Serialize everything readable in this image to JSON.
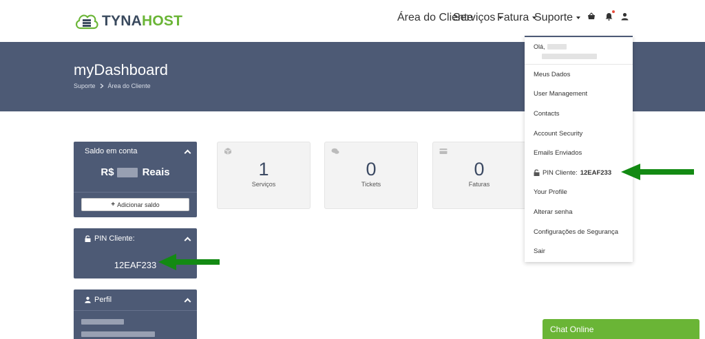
{
  "brand": {
    "name_part1": "TYNA",
    "name_part2": "HOST"
  },
  "nav": {
    "area_cliente": "Área do Cliente",
    "servicos": "Serviços",
    "fatura": "Fatura",
    "suporte": "Suporte"
  },
  "banner": {
    "title": "myDashboard",
    "breadcrumb": [
      "Suporte",
      "Área do Cliente"
    ]
  },
  "saldo_panel": {
    "title": "Saldo em conta",
    "currency": "R$",
    "unit": "Reais",
    "add_button": "Adicionar saldo"
  },
  "pin_panel": {
    "title": "PIN Cliente:",
    "value": "12EAF233"
  },
  "perfil_panel": {
    "title": "Perfil"
  },
  "stats": [
    {
      "value": "1",
      "label": "Serviços",
      "icon": "cube-icon"
    },
    {
      "value": "0",
      "label": "Tickets",
      "icon": "comments-icon"
    },
    {
      "value": "0",
      "label": "Faturas",
      "icon": "credit-card-icon"
    }
  ],
  "dropdown": {
    "hello": "Olá,",
    "items": [
      "Meus Dados",
      "User Management",
      "Contacts",
      "Account Security",
      "Emails Enviados",
      "PIN Cliente:",
      "Your Profile",
      "Alterar senha",
      "Configurações de Segurança",
      "Sair"
    ],
    "pin_value": "12EAF233"
  },
  "chat": {
    "label": "Chat Online"
  },
  "colors": {
    "banner": "#4d5a75",
    "accent_green": "#6ab536",
    "arrow_green": "#138a13"
  }
}
